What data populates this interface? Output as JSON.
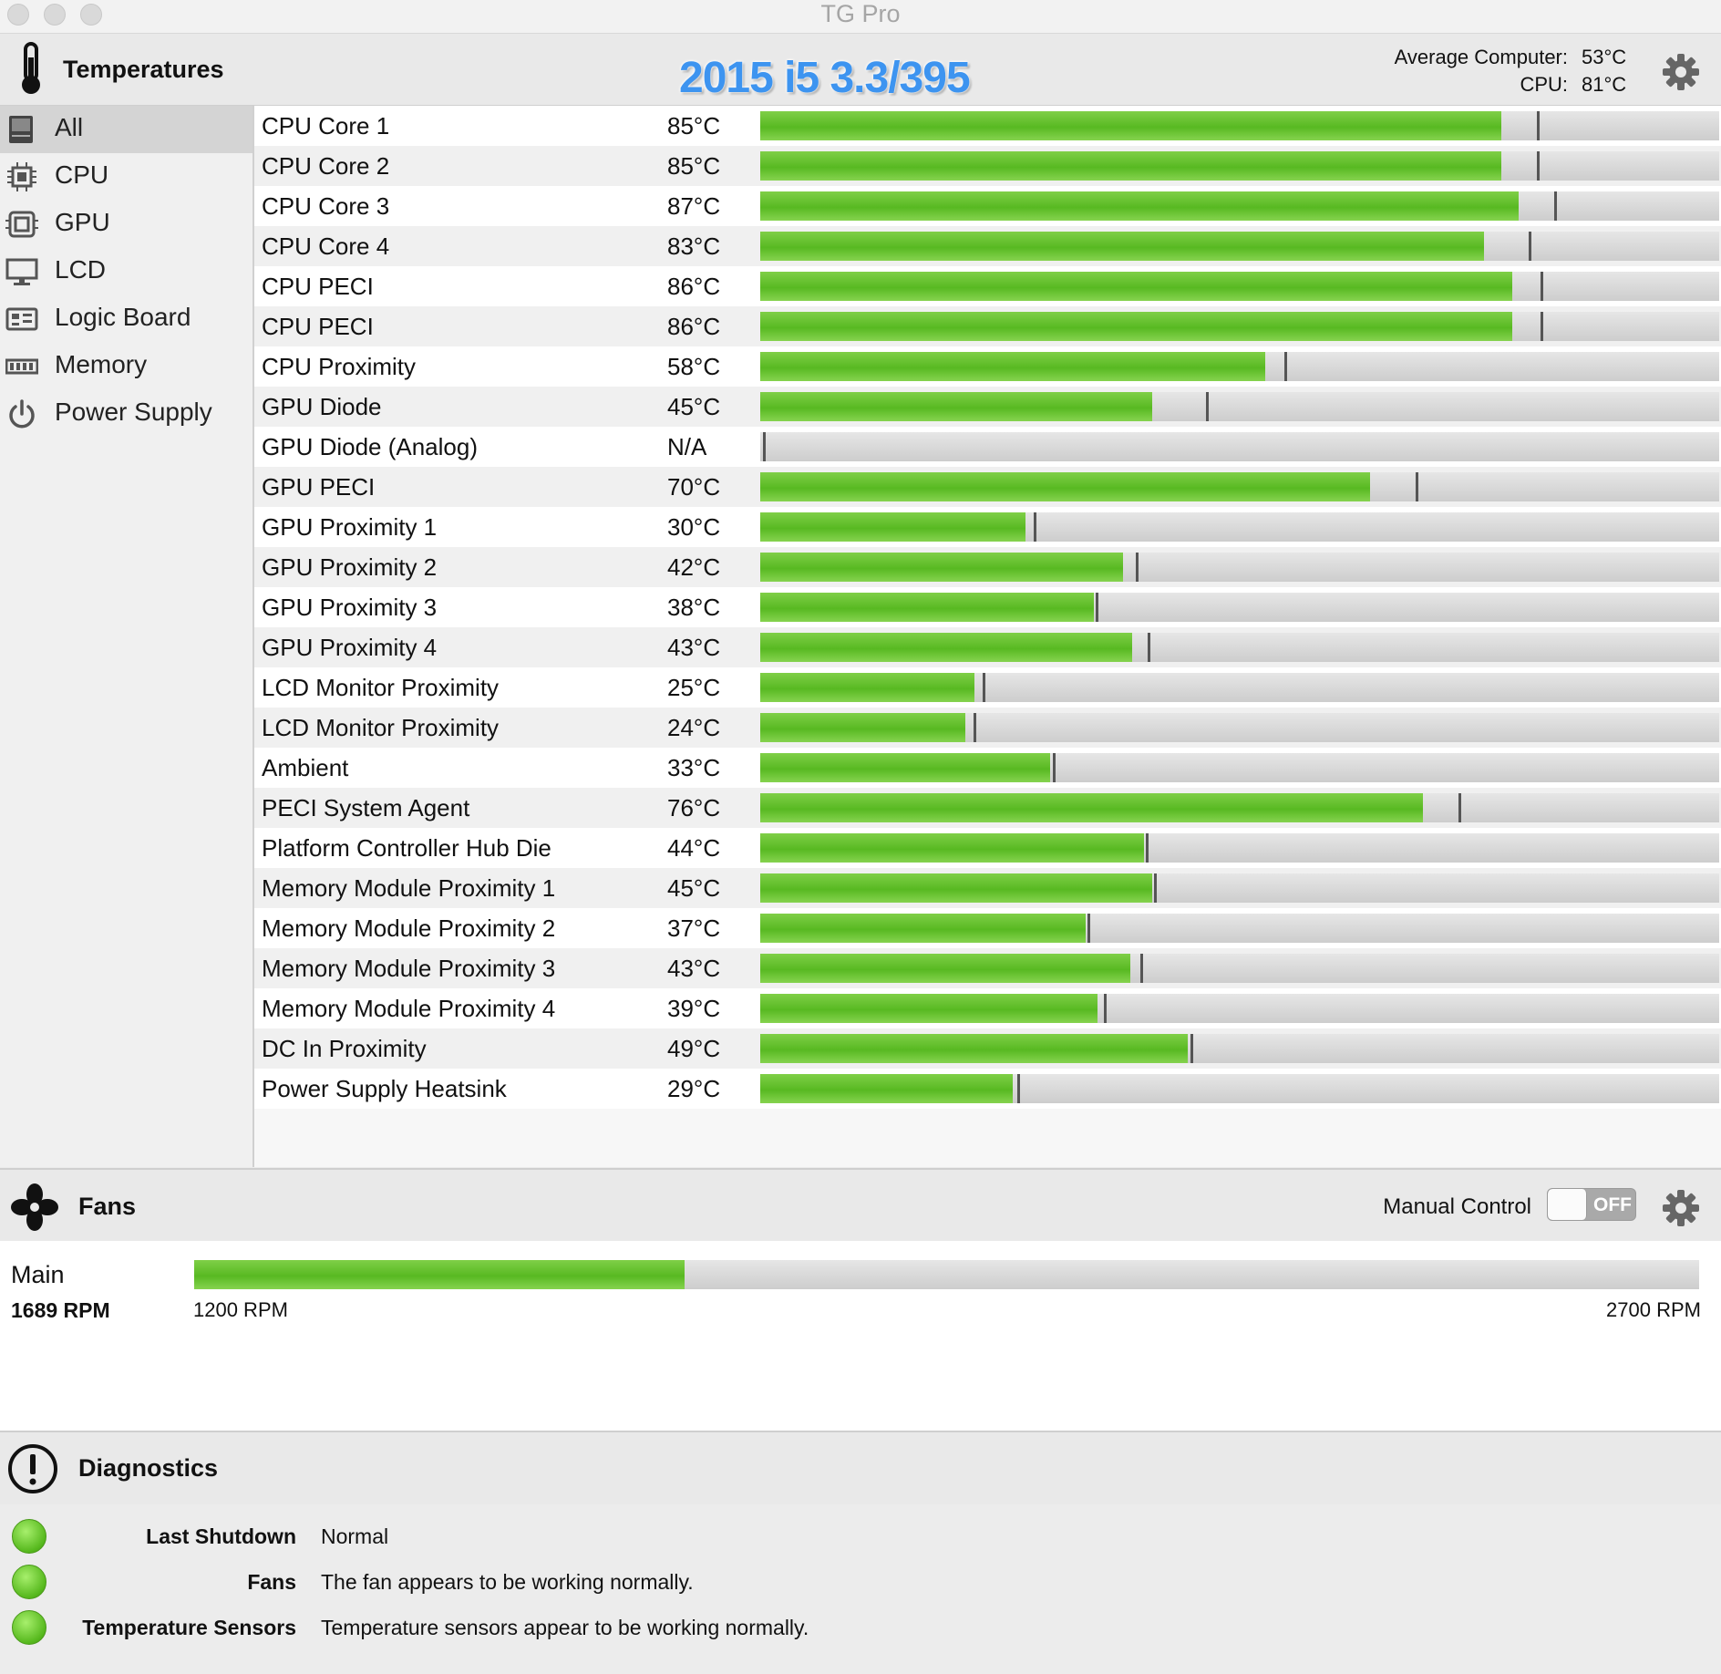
{
  "window": {
    "title": "TG Pro"
  },
  "temperatures": {
    "title": "Temperatures",
    "overlay_label": "2015 i5 3.3/395",
    "average_label": "Average Computer:",
    "average_value": "53°C",
    "cpu_label": "CPU:",
    "cpu_value": "81°C",
    "sidebar": [
      {
        "label": "All",
        "icon": "computer-icon",
        "selected": true
      },
      {
        "label": "CPU",
        "icon": "cpu-chip-icon"
      },
      {
        "label": "GPU",
        "icon": "gpu-chip-icon"
      },
      {
        "label": "LCD",
        "icon": "display-icon"
      },
      {
        "label": "Logic Board",
        "icon": "logic-board-icon"
      },
      {
        "label": "Memory",
        "icon": "memory-icon"
      },
      {
        "label": "Power Supply",
        "icon": "power-icon"
      }
    ],
    "sensors": [
      {
        "name": "CPU Core 1",
        "value": "85°C",
        "fill": 0.773,
        "max": 0.81
      },
      {
        "name": "CPU Core 2",
        "value": "85°C",
        "fill": 0.773,
        "max": 0.81
      },
      {
        "name": "CPU Core 3",
        "value": "87°C",
        "fill": 0.791,
        "max": 0.828
      },
      {
        "name": "CPU Core 4",
        "value": "83°C",
        "fill": 0.755,
        "max": 0.801
      },
      {
        "name": "CPU PECI",
        "value": "86°C",
        "fill": 0.784,
        "max": 0.814
      },
      {
        "name": "CPU PECI",
        "value": "86°C",
        "fill": 0.784,
        "max": 0.814
      },
      {
        "name": "CPU Proximity",
        "value": "58°C",
        "fill": 0.527,
        "max": 0.547
      },
      {
        "name": "GPU Diode",
        "value": "45°C",
        "fill": 0.409,
        "max": 0.465
      },
      {
        "name": "GPU Diode (Analog)",
        "value": "N/A",
        "fill": 0.0,
        "max": 0.003
      },
      {
        "name": "GPU PECI",
        "value": "70°C",
        "fill": 0.636,
        "max": 0.683
      },
      {
        "name": "GPU Proximity 1",
        "value": "30°C",
        "fill": 0.277,
        "max": 0.285
      },
      {
        "name": "GPU Proximity 2",
        "value": "42°C",
        "fill": 0.378,
        "max": 0.392
      },
      {
        "name": "GPU Proximity 3",
        "value": "38°C",
        "fill": 0.348,
        "max": 0.35
      },
      {
        "name": "GPU Proximity 4",
        "value": "43°C",
        "fill": 0.388,
        "max": 0.404
      },
      {
        "name": "LCD Monitor Proximity",
        "value": "25°C",
        "fill": 0.223,
        "max": 0.232
      },
      {
        "name": "LCD Monitor Proximity",
        "value": "24°C",
        "fill": 0.214,
        "max": 0.222
      },
      {
        "name": "Ambient",
        "value": "33°C",
        "fill": 0.302,
        "max": 0.305
      },
      {
        "name": "PECI System Agent",
        "value": "76°C",
        "fill": 0.691,
        "max": 0.728
      },
      {
        "name": "Platform Controller Hub Die",
        "value": "44°C",
        "fill": 0.4,
        "max": 0.402
      },
      {
        "name": "Memory Module Proximity 1",
        "value": "45°C",
        "fill": 0.409,
        "max": 0.411
      },
      {
        "name": "Memory Module Proximity 2",
        "value": "37°C",
        "fill": 0.339,
        "max": 0.341
      },
      {
        "name": "Memory Module Proximity 3",
        "value": "43°C",
        "fill": 0.386,
        "max": 0.396
      },
      {
        "name": "Memory Module Proximity 4",
        "value": "39°C",
        "fill": 0.352,
        "max": 0.358
      },
      {
        "name": "DC In Proximity",
        "value": "49°C",
        "fill": 0.446,
        "max": 0.449
      },
      {
        "name": "Power Supply Heatsink",
        "value": "29°C",
        "fill": 0.263,
        "max": 0.268
      }
    ]
  },
  "fans": {
    "title": "Fans",
    "manual_control_label": "Manual Control",
    "toggle_label": "OFF",
    "main_label": "Main",
    "current_rpm": "1689 RPM",
    "min_rpm": "1200 RPM",
    "max_rpm": "2700 RPM",
    "fill": 0.326
  },
  "diagnostics": {
    "title": "Diagnostics",
    "items": [
      {
        "label": "Last Shutdown",
        "text": "Normal"
      },
      {
        "label": "Fans",
        "text": "The fan appears to be working normally."
      },
      {
        "label": "Temperature Sensors",
        "text": "Temperature sensors appear to be working normally."
      }
    ]
  },
  "colors": {
    "bar_green": "#5cbb25",
    "status_green": "#56b81d",
    "overlay_blue": "#3d94f0"
  }
}
